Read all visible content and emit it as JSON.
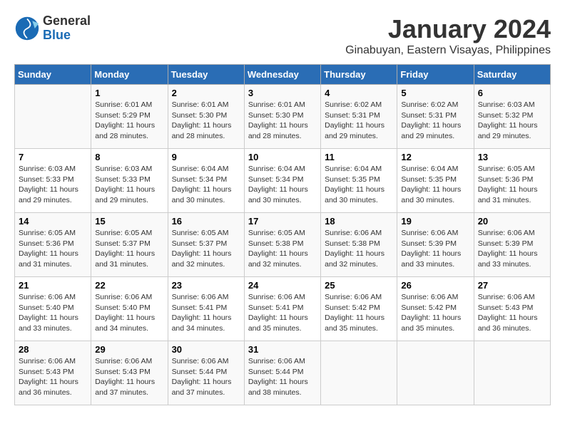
{
  "logo": {
    "general": "General",
    "blue": "Blue"
  },
  "title": "January 2024",
  "location": "Ginabuyan, Eastern Visayas, Philippines",
  "days_of_week": [
    "Sunday",
    "Monday",
    "Tuesday",
    "Wednesday",
    "Thursday",
    "Friday",
    "Saturday"
  ],
  "weeks": [
    [
      {
        "day": "",
        "sunrise": "",
        "sunset": "",
        "daylight": ""
      },
      {
        "day": "1",
        "sunrise": "Sunrise: 6:01 AM",
        "sunset": "Sunset: 5:29 PM",
        "daylight": "Daylight: 11 hours and 28 minutes."
      },
      {
        "day": "2",
        "sunrise": "Sunrise: 6:01 AM",
        "sunset": "Sunset: 5:30 PM",
        "daylight": "Daylight: 11 hours and 28 minutes."
      },
      {
        "day": "3",
        "sunrise": "Sunrise: 6:01 AM",
        "sunset": "Sunset: 5:30 PM",
        "daylight": "Daylight: 11 hours and 28 minutes."
      },
      {
        "day": "4",
        "sunrise": "Sunrise: 6:02 AM",
        "sunset": "Sunset: 5:31 PM",
        "daylight": "Daylight: 11 hours and 29 minutes."
      },
      {
        "day": "5",
        "sunrise": "Sunrise: 6:02 AM",
        "sunset": "Sunset: 5:31 PM",
        "daylight": "Daylight: 11 hours and 29 minutes."
      },
      {
        "day": "6",
        "sunrise": "Sunrise: 6:03 AM",
        "sunset": "Sunset: 5:32 PM",
        "daylight": "Daylight: 11 hours and 29 minutes."
      }
    ],
    [
      {
        "day": "7",
        "sunrise": "Sunrise: 6:03 AM",
        "sunset": "Sunset: 5:33 PM",
        "daylight": "Daylight: 11 hours and 29 minutes."
      },
      {
        "day": "8",
        "sunrise": "Sunrise: 6:03 AM",
        "sunset": "Sunset: 5:33 PM",
        "daylight": "Daylight: 11 hours and 29 minutes."
      },
      {
        "day": "9",
        "sunrise": "Sunrise: 6:04 AM",
        "sunset": "Sunset: 5:34 PM",
        "daylight": "Daylight: 11 hours and 30 minutes."
      },
      {
        "day": "10",
        "sunrise": "Sunrise: 6:04 AM",
        "sunset": "Sunset: 5:34 PM",
        "daylight": "Daylight: 11 hours and 30 minutes."
      },
      {
        "day": "11",
        "sunrise": "Sunrise: 6:04 AM",
        "sunset": "Sunset: 5:35 PM",
        "daylight": "Daylight: 11 hours and 30 minutes."
      },
      {
        "day": "12",
        "sunrise": "Sunrise: 6:04 AM",
        "sunset": "Sunset: 5:35 PM",
        "daylight": "Daylight: 11 hours and 30 minutes."
      },
      {
        "day": "13",
        "sunrise": "Sunrise: 6:05 AM",
        "sunset": "Sunset: 5:36 PM",
        "daylight": "Daylight: 11 hours and 31 minutes."
      }
    ],
    [
      {
        "day": "14",
        "sunrise": "Sunrise: 6:05 AM",
        "sunset": "Sunset: 5:36 PM",
        "daylight": "Daylight: 11 hours and 31 minutes."
      },
      {
        "day": "15",
        "sunrise": "Sunrise: 6:05 AM",
        "sunset": "Sunset: 5:37 PM",
        "daylight": "Daylight: 11 hours and 31 minutes."
      },
      {
        "day": "16",
        "sunrise": "Sunrise: 6:05 AM",
        "sunset": "Sunset: 5:37 PM",
        "daylight": "Daylight: 11 hours and 32 minutes."
      },
      {
        "day": "17",
        "sunrise": "Sunrise: 6:05 AM",
        "sunset": "Sunset: 5:38 PM",
        "daylight": "Daylight: 11 hours and 32 minutes."
      },
      {
        "day": "18",
        "sunrise": "Sunrise: 6:06 AM",
        "sunset": "Sunset: 5:38 PM",
        "daylight": "Daylight: 11 hours and 32 minutes."
      },
      {
        "day": "19",
        "sunrise": "Sunrise: 6:06 AM",
        "sunset": "Sunset: 5:39 PM",
        "daylight": "Daylight: 11 hours and 33 minutes."
      },
      {
        "day": "20",
        "sunrise": "Sunrise: 6:06 AM",
        "sunset": "Sunset: 5:39 PM",
        "daylight": "Daylight: 11 hours and 33 minutes."
      }
    ],
    [
      {
        "day": "21",
        "sunrise": "Sunrise: 6:06 AM",
        "sunset": "Sunset: 5:40 PM",
        "daylight": "Daylight: 11 hours and 33 minutes."
      },
      {
        "day": "22",
        "sunrise": "Sunrise: 6:06 AM",
        "sunset": "Sunset: 5:40 PM",
        "daylight": "Daylight: 11 hours and 34 minutes."
      },
      {
        "day": "23",
        "sunrise": "Sunrise: 6:06 AM",
        "sunset": "Sunset: 5:41 PM",
        "daylight": "Daylight: 11 hours and 34 minutes."
      },
      {
        "day": "24",
        "sunrise": "Sunrise: 6:06 AM",
        "sunset": "Sunset: 5:41 PM",
        "daylight": "Daylight: 11 hours and 35 minutes."
      },
      {
        "day": "25",
        "sunrise": "Sunrise: 6:06 AM",
        "sunset": "Sunset: 5:42 PM",
        "daylight": "Daylight: 11 hours and 35 minutes."
      },
      {
        "day": "26",
        "sunrise": "Sunrise: 6:06 AM",
        "sunset": "Sunset: 5:42 PM",
        "daylight": "Daylight: 11 hours and 35 minutes."
      },
      {
        "day": "27",
        "sunrise": "Sunrise: 6:06 AM",
        "sunset": "Sunset: 5:43 PM",
        "daylight": "Daylight: 11 hours and 36 minutes."
      }
    ],
    [
      {
        "day": "28",
        "sunrise": "Sunrise: 6:06 AM",
        "sunset": "Sunset: 5:43 PM",
        "daylight": "Daylight: 11 hours and 36 minutes."
      },
      {
        "day": "29",
        "sunrise": "Sunrise: 6:06 AM",
        "sunset": "Sunset: 5:43 PM",
        "daylight": "Daylight: 11 hours and 37 minutes."
      },
      {
        "day": "30",
        "sunrise": "Sunrise: 6:06 AM",
        "sunset": "Sunset: 5:44 PM",
        "daylight": "Daylight: 11 hours and 37 minutes."
      },
      {
        "day": "31",
        "sunrise": "Sunrise: 6:06 AM",
        "sunset": "Sunset: 5:44 PM",
        "daylight": "Daylight: 11 hours and 38 minutes."
      },
      {
        "day": "",
        "sunrise": "",
        "sunset": "",
        "daylight": ""
      },
      {
        "day": "",
        "sunrise": "",
        "sunset": "",
        "daylight": ""
      },
      {
        "day": "",
        "sunrise": "",
        "sunset": "",
        "daylight": ""
      }
    ]
  ]
}
